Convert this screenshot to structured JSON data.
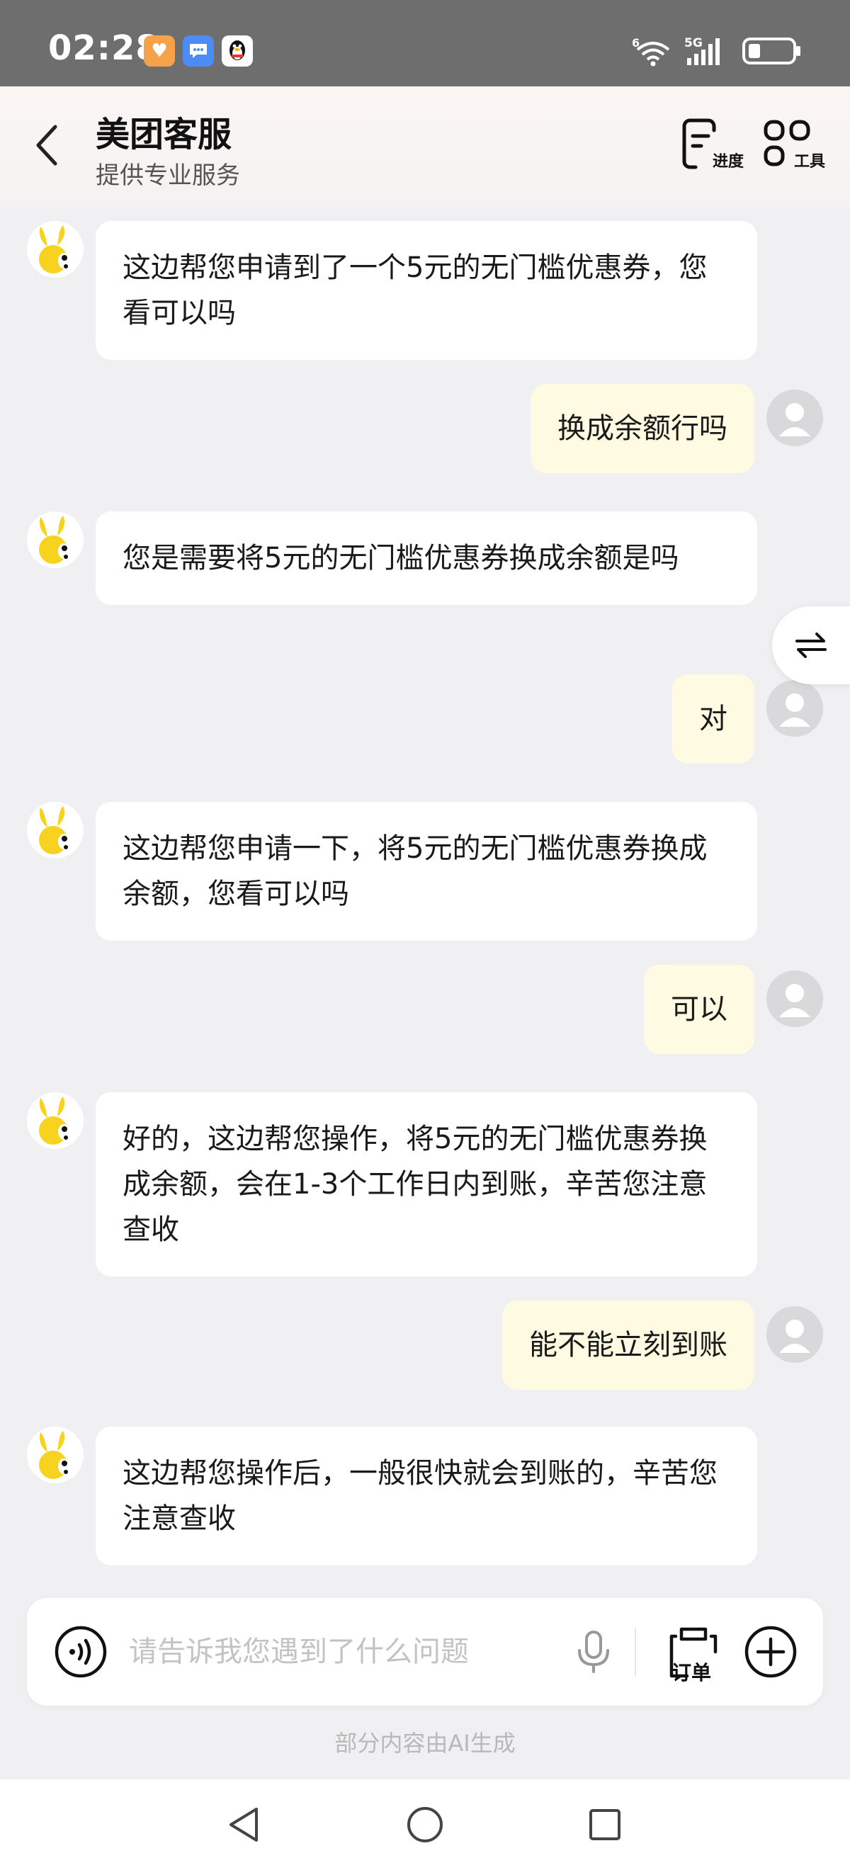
{
  "status_bar": {
    "time": "02:28",
    "network": "5G",
    "wifi_label": "6",
    "icons": [
      "heart-app-icon",
      "message-app-icon",
      "qq-app-icon",
      "wifi-icon",
      "signal-icon",
      "battery-icon"
    ]
  },
  "header": {
    "title": "美团客服",
    "subtitle": "提供专业服务",
    "progress_label": "进度",
    "tools_label": "工具"
  },
  "messages": [
    {
      "from": "bot",
      "text": "这边帮您申请到了一个5元的无门槛优惠券，您看可以吗"
    },
    {
      "from": "user",
      "text": "换成余额行吗"
    },
    {
      "from": "bot",
      "text": "您是需要将5元的无门槛优惠券换成余额是吗"
    },
    {
      "from": "user",
      "text": "对"
    },
    {
      "from": "bot",
      "text": "这边帮您申请一下，将5元的无门槛优惠券换成余额，您看可以吗"
    },
    {
      "from": "user",
      "text": "可以"
    },
    {
      "from": "bot",
      "text": "好的，这边帮您操作，将5元的无门槛优惠券换成余额，会在1-3个工作日内到账，辛苦您注意查收"
    },
    {
      "from": "user",
      "text": "能不能立刻到账"
    },
    {
      "from": "bot",
      "text": "这边帮您操作后，一般很快就会到账的，辛苦您注意查收"
    }
  ],
  "input": {
    "placeholder": "请告诉我您遇到了什么问题",
    "value": "",
    "order_label": "订单"
  },
  "footer_note": "部分内容由AI生成",
  "colors": {
    "bot_bubble": "#ffffff",
    "user_bubble": "#fffbe2",
    "mascot": "#f7d21e"
  }
}
